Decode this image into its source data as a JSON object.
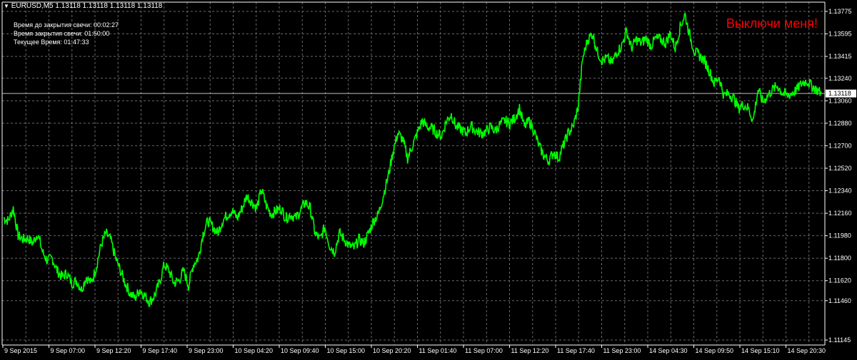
{
  "window": {
    "symbol_line": "EURUSD,M5  1.13118 1.13118 1.13118 1.13118",
    "menu_icon": "triangle-down-icon"
  },
  "overlay": {
    "line1": "Время до закрытия свечи: 00:02:27",
    "line2": "Время закрытия свечи: 01:50:00",
    "line3": "Текущее Время: 01:47:33"
  },
  "toggle": {
    "label": "Выключи меня!",
    "color": "#ff0000"
  },
  "colors": {
    "background": "#000000",
    "price_line": "#00ff00",
    "grid": "#6a6a6a",
    "axis_text": "#ffffff",
    "current_price_line": "#c0c0c0"
  },
  "chart_data": {
    "type": "line",
    "title": "EURUSD,M5",
    "grid": true,
    "ylim": [
      1.11145,
      1.13775
    ],
    "y_ticks": [
      "1.13775",
      "1.13595",
      "1.13415",
      "1.13240",
      "1.13060",
      "1.12880",
      "1.12700",
      "1.12520",
      "1.12340",
      "1.12160",
      "1.11980",
      "1.11800",
      "1.11620",
      "1.11460",
      "1.11145"
    ],
    "x_ticks": [
      "9 Sep 2015",
      "9 Sep 07:00",
      "9 Sep 12:20",
      "9 Sep 17:40",
      "9 Sep 23:00",
      "10 Sep 04:20",
      "10 Sep 09:40",
      "10 Sep 15:00",
      "10 Sep 20:20",
      "11 Sep 01:40",
      "11 Sep 07:00",
      "11 Sep 12:20",
      "11 Sep 17:40",
      "11 Sep 23:00",
      "14 Sep 04:30",
      "14 Sep 09:50",
      "14 Sep 15:10",
      "14 Sep 20:30"
    ],
    "current_price": "1.13118",
    "series": [
      {
        "values": [
          1.1212,
          1.121,
          1.122,
          1.1198,
          1.1195,
          1.1196,
          1.1192,
          1.12,
          1.1185,
          1.1178,
          1.118,
          1.117,
          1.1165,
          1.1168,
          1.116,
          1.1162,
          1.1155,
          1.1165,
          1.116,
          1.1172,
          1.119,
          1.12,
          1.1195,
          1.118,
          1.117,
          1.116,
          1.1152,
          1.1148,
          1.1155,
          1.115,
          1.1145,
          1.115,
          1.116,
          1.1175,
          1.117,
          1.116,
          1.1162,
          1.117,
          1.1158,
          1.1175,
          1.118,
          1.12,
          1.121,
          1.1205,
          1.12,
          1.121,
          1.1215,
          1.1218,
          1.1212,
          1.122,
          1.123,
          1.1225,
          1.122,
          1.1235,
          1.1222,
          1.1215,
          1.1218,
          1.122,
          1.1212,
          1.1215,
          1.1212,
          1.1218,
          1.1225,
          1.122,
          1.12,
          1.1195,
          1.1205,
          1.119,
          1.1185,
          1.12,
          1.1195,
          1.119,
          1.1188,
          1.1195,
          1.1192,
          1.12,
          1.121,
          1.1215,
          1.123,
          1.1245,
          1.1265,
          1.128,
          1.1275,
          1.126,
          1.127,
          1.128,
          1.129,
          1.1285,
          1.1284,
          1.128,
          1.1278,
          1.129,
          1.1295,
          1.1285,
          1.1283,
          1.128,
          1.1286,
          1.1282,
          1.128,
          1.1281,
          1.1285,
          1.1282,
          1.1287,
          1.129,
          1.1288,
          1.1292,
          1.13,
          1.1285,
          1.129,
          1.1282,
          1.127,
          1.1262,
          1.1258,
          1.1265,
          1.126,
          1.127,
          1.128,
          1.1285,
          1.13,
          1.134,
          1.1355,
          1.136,
          1.1345,
          1.1338,
          1.134,
          1.1336,
          1.1345,
          1.135,
          1.1362,
          1.1348,
          1.1355,
          1.1352,
          1.1356,
          1.135,
          1.1356,
          1.1355,
          1.1352,
          1.136,
          1.1348,
          1.1365,
          1.1375,
          1.1358,
          1.1345,
          1.1342,
          1.1338,
          1.133,
          1.132,
          1.1325,
          1.131,
          1.1312,
          1.1308,
          1.13,
          1.1303,
          1.13,
          1.129,
          1.1315,
          1.1305,
          1.131,
          1.1315,
          1.1318,
          1.1312,
          1.131,
          1.1312,
          1.1315,
          1.132,
          1.1322,
          1.1318,
          1.1315,
          1.1312
        ]
      }
    ]
  }
}
